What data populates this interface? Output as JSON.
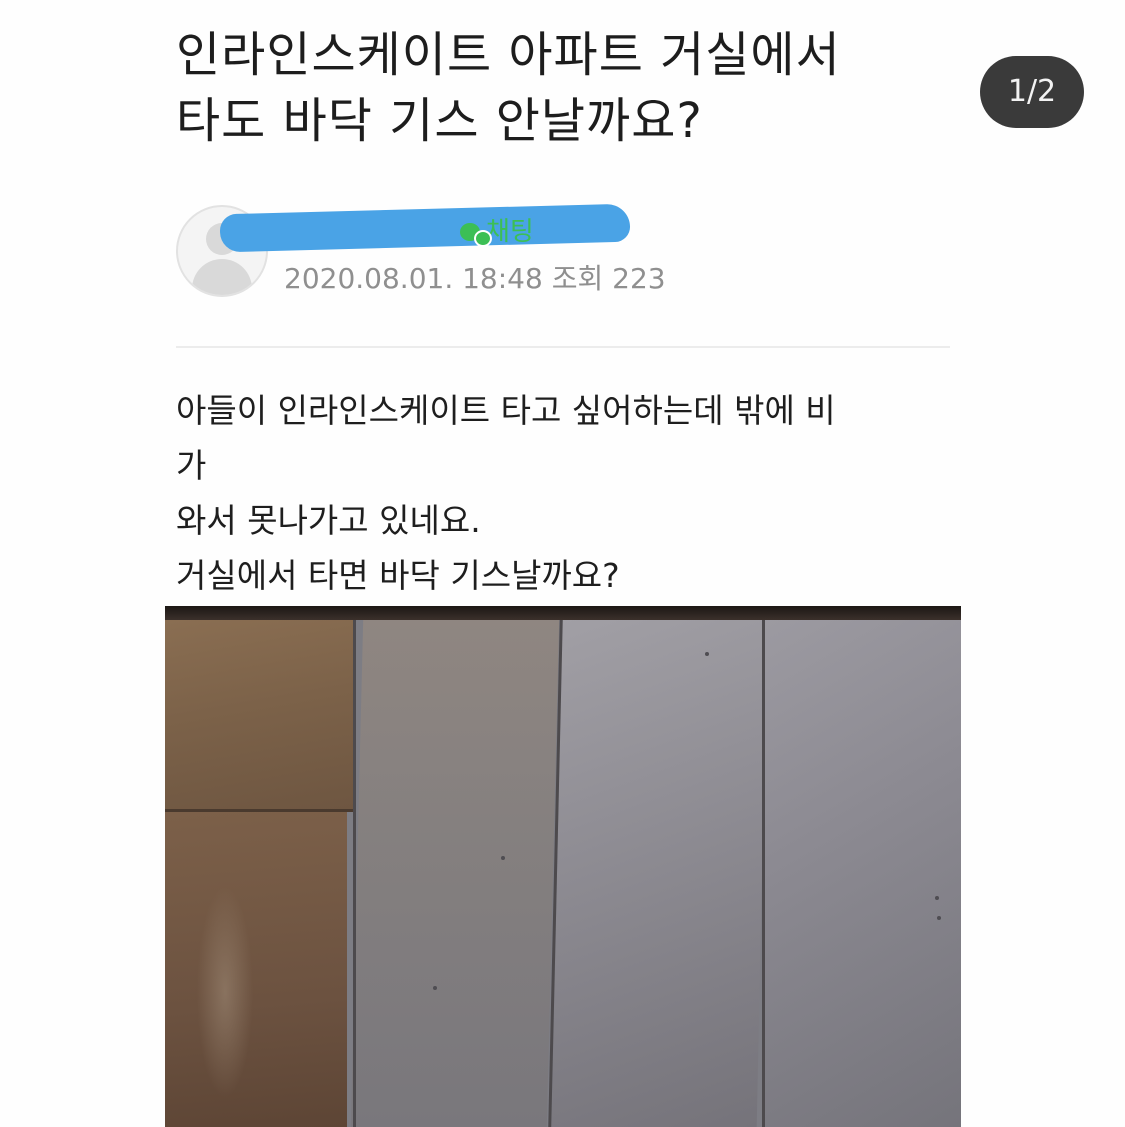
{
  "post": {
    "title_line1": "인라인스케이트 아파트 거실에서",
    "title_line2": "타도 바닥 기스 안날까요?",
    "chat_label": "채팅",
    "date": "2020.08.01. 18:48",
    "views_label": "조회",
    "views": "223",
    "body_lines": [
      "아들이 인라인스케이트 타고 싶어하는데 밖에 비",
      "가",
      "와서 못나가고 있네요.",
      "거실에서 타면 바닥 기스날까요?"
    ]
  },
  "overlay": {
    "page_counter": "1/2"
  },
  "colors": {
    "chat_green": "#3cbf55",
    "redaction_blue": "#4aa3e6",
    "counter_bg": "#3a3a3a",
    "meta_gray": "#8f8f8f"
  },
  "icons": {
    "avatar": "default-profile-icon",
    "chat": "chat-bubble-icon"
  }
}
